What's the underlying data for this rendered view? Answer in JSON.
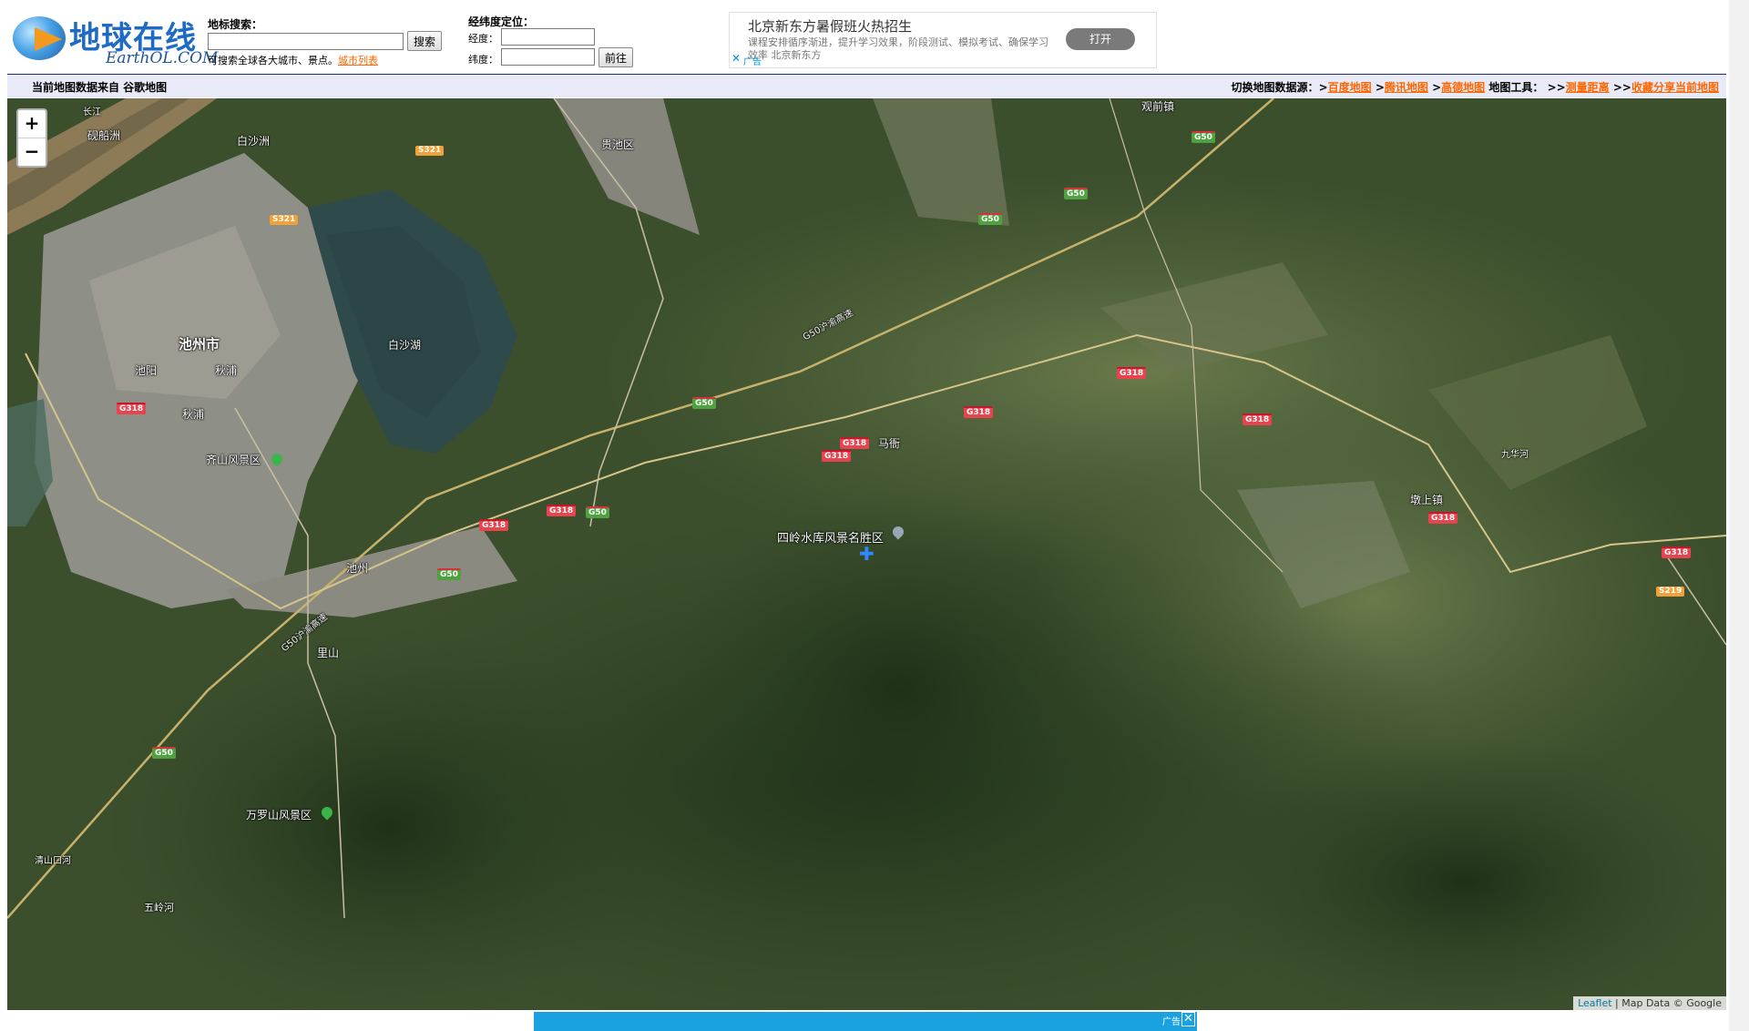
{
  "logo": {
    "title": "地球在线",
    "subtitle": "EarthOL.COM"
  },
  "search": {
    "label": "地标搜索：",
    "input_value": "",
    "button": "搜索",
    "hint": "可搜索全球各大城市、景点。",
    "city_list_link": "城市列表"
  },
  "coords": {
    "label": "经纬度定位：",
    "lng_label": "经度：",
    "lat_label": "纬度：",
    "lng_value": "",
    "lat_value": "",
    "button": "前往"
  },
  "ad": {
    "title": "北京新东方暑假班火热招生",
    "description": "课程安排循序渐进，提升学习效果，阶段测试、模拟考试、确保学习效率 北京新东方",
    "button": "打开",
    "tag": "广告",
    "close": "✕"
  },
  "bar": {
    "source_text": "当前地图数据来自 谷歌地图",
    "switch_label": "切换地图数据源：",
    "sep": ">",
    "sources": [
      "百度地图",
      "腾讯地图",
      "高德地图"
    ],
    "tools_label": "地图工具：",
    "tools_sep": ">>",
    "tools": [
      "测量距离",
      "收藏分享当前地图"
    ]
  },
  "map": {
    "zoom_in": "+",
    "zoom_out": "−",
    "places": {
      "chizhou_city": "池州市",
      "baishazhou": "白沙洲",
      "yanchuanzhou": "砚船洲",
      "changjiang": "长江",
      "guichiqu": "贵池区",
      "baishahu": "白沙湖",
      "chiyang": "池阳",
      "qiuyang": "秋浦",
      "qiupu": "秋浦",
      "qishan": "齐山风景区",
      "chizhou_station": "池州",
      "lishan": "里山",
      "wanluoshan": "万罗山风景区",
      "maya": "马衙",
      "siling": "四岭水库风景名胜区",
      "dunshang": "墩上镇",
      "jiuhuahe": "九华河",
      "guanqian": "观前镇",
      "qingshanxiang": "清山口河",
      "wulinghe": "五岭河",
      "g50_road": "G50沪渝高速",
      "g50_road2": "G50沪渝高速"
    },
    "shields": {
      "s321": "S321",
      "g318": "G318",
      "g50": "G50",
      "s219": "S219"
    },
    "attribution_leaflet": "Leaflet",
    "attribution_rest": " | Map Data © Google"
  },
  "bottom_ad": {
    "tag": "广告",
    "close": "✕"
  },
  "colors": {
    "link": "#ff6600",
    "bar_bg": "#e9eaf7",
    "bar_border": "#1e2a8a",
    "ad_blue": "#19a1e0"
  }
}
